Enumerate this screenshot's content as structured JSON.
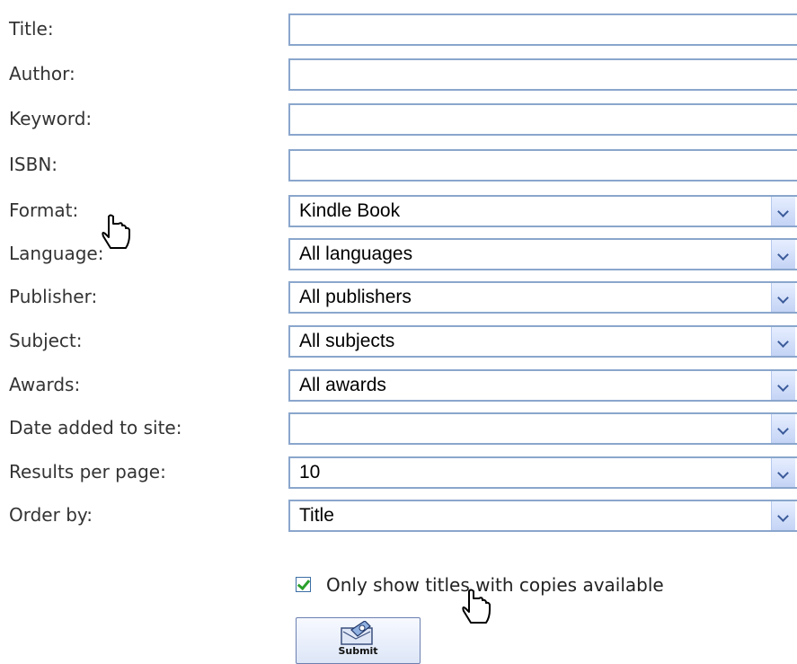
{
  "fields": [
    {
      "label": "Title:",
      "type": "text",
      "value": ""
    },
    {
      "label": "Author:",
      "type": "text",
      "value": ""
    },
    {
      "label": "Keyword:",
      "type": "text",
      "value": ""
    },
    {
      "label": "ISBN:",
      "type": "text",
      "value": ""
    },
    {
      "label": "Format:",
      "type": "select",
      "value": "Kindle Book"
    },
    {
      "label": "Language:",
      "type": "select",
      "value": "All languages"
    },
    {
      "label": "Publisher:",
      "type": "select",
      "value": "All publishers"
    },
    {
      "label": "Subject:",
      "type": "select",
      "value": "All subjects"
    },
    {
      "label": "Awards:",
      "type": "select",
      "value": "All awards"
    },
    {
      "label": "Date added to site:",
      "type": "select",
      "value": ""
    },
    {
      "label": "Results per page:",
      "type": "select",
      "value": "10"
    },
    {
      "label": "Order by:",
      "type": "select",
      "value": "Title"
    }
  ],
  "available_only": {
    "label": "Only show titles with copies available",
    "checked": true
  },
  "submit": {
    "label": "Submit",
    "icon": "submit-form-icon"
  },
  "icons": {
    "cursor": "hand-pointer-icon",
    "dropdown": "chevron-down-icon"
  }
}
